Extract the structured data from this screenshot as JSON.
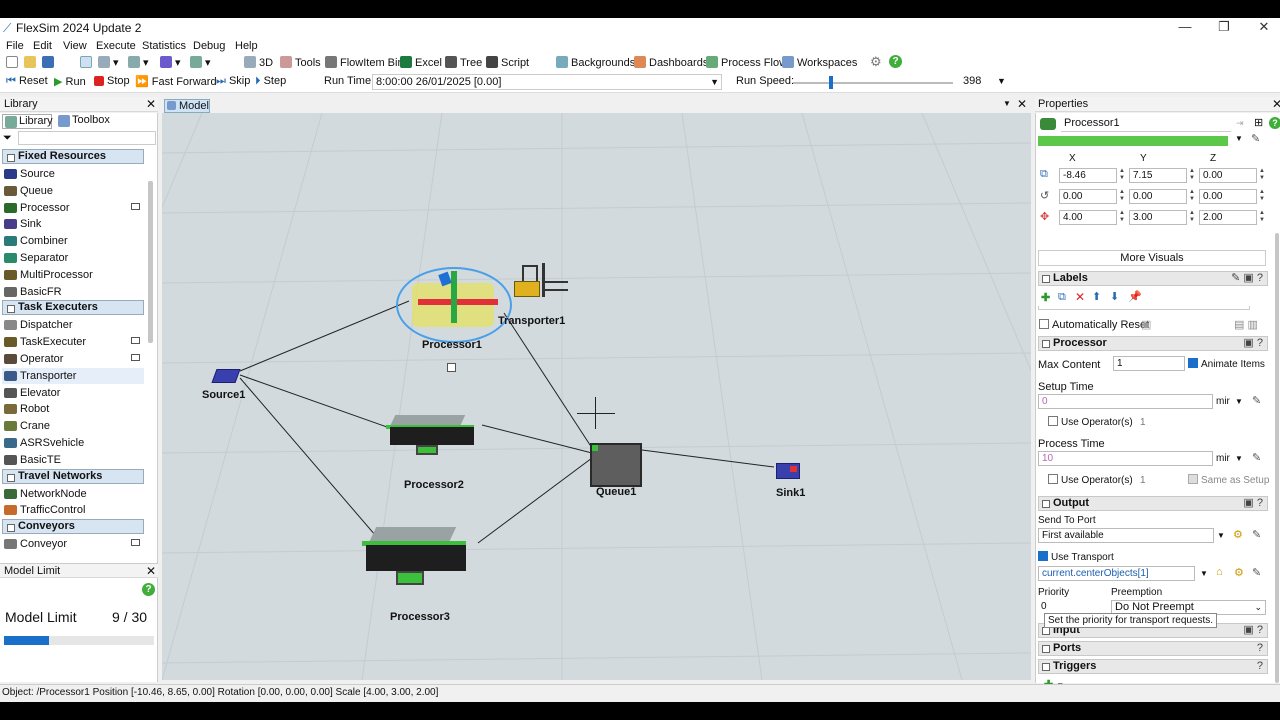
{
  "window": {
    "title": "FlexSim 2024 Update 2",
    "minimize": "—",
    "maximize": "❐",
    "close": "✕"
  },
  "menu": [
    "File",
    "Edit",
    "View",
    "Execute",
    "Statistics",
    "Debug",
    "Help"
  ],
  "toolbar": {
    "view3d": "3D",
    "tools": "Tools",
    "flowitem_bin": "FlowItem Bin",
    "excel": "Excel",
    "tree": "Tree",
    "script": "Script",
    "backgrounds": "Backgrounds",
    "dashboards": "Dashboards",
    "process_flow": "Process Flow",
    "workspaces": "Workspaces"
  },
  "run_controls": {
    "reset": "Reset",
    "run": "Run",
    "stop": "Stop",
    "fast_forward": "Fast Forward",
    "skip": "Skip",
    "step": "Step",
    "run_time_label": "Run Time:",
    "run_time_value": "8:00:00  26/01/2025  [0.00]",
    "run_speed_label": "Run Speed:",
    "run_speed_value": "398"
  },
  "library": {
    "title": "Library",
    "tabs": [
      "Library",
      "Toolbox"
    ],
    "categories": [
      {
        "name": "Fixed Resources",
        "items": [
          "Source",
          "Queue",
          "Processor",
          "Sink",
          "Combiner",
          "Separator",
          "MultiProcessor",
          "BasicFR"
        ]
      },
      {
        "name": "Task Executers",
        "items": [
          "Dispatcher",
          "TaskExecuter",
          "Operator",
          "Transporter",
          "Elevator",
          "Robot",
          "Crane",
          "ASRSvehicle",
          "BasicTE"
        ]
      },
      {
        "name": "Travel Networks",
        "items": [
          "NetworkNode",
          "TrafficControl"
        ]
      },
      {
        "name": "Conveyors",
        "items": [
          "Conveyor"
        ]
      }
    ]
  },
  "model_limit": {
    "panel_title": "Model Limit",
    "label": "Model Limit",
    "value": "9 / 30",
    "progress": 0.3
  },
  "model_tab": "Model",
  "objects": {
    "source": "Source1",
    "processor1": "Processor1",
    "transporter": "Transporter1",
    "processor2": "Processor2",
    "processor3": "Processor3",
    "queue": "Queue1",
    "sink": "Sink1"
  },
  "properties": {
    "title": "Properties",
    "object_name": "Processor1",
    "axes": [
      "X",
      "Y",
      "Z"
    ],
    "position": [
      "-8.46",
      "7.15",
      "0.00"
    ],
    "rotation": [
      "0.00",
      "0.00",
      "0.00"
    ],
    "size": [
      "4.00",
      "3.00",
      "2.00"
    ],
    "more_visuals": "More Visuals",
    "labels_section": "Labels",
    "auto_reset": "Automatically Reset",
    "processor_section": "Processor",
    "max_content_label": "Max Content",
    "max_content": "1",
    "animate_items": "Animate Items",
    "setup_time_label": "Setup Time",
    "setup_time": "0",
    "time_unit": "mir",
    "use_operators": "Use Operator(s)",
    "operator_count": "1",
    "process_time_label": "Process Time",
    "process_time": "10",
    "same_as_setup": "Same as Setup",
    "output_section": "Output",
    "send_to_port_label": "Send To Port",
    "send_to_port": "First available",
    "use_transport": "Use Transport",
    "transport_expr": "current.centerObjects[1]",
    "priority_label": "Priority",
    "priority_value": "0",
    "preemption_label": "Preemption",
    "preemption": "Do Not Preempt",
    "tooltip": "Set the priority for transport requests.",
    "input_section": "Input",
    "ports_section": "Ports",
    "triggers_section": "Triggers"
  },
  "status": "Object: /Processor1 Position [-10.46, 8.65, 0.00]  Rotation [0.00, 0.00, 0.00]  Scale [4.00, 3.00, 2.00]",
  "colors": {
    "accent": "#1a6fc9",
    "green_bar": "#5bc84a",
    "viewport": "#d2dade"
  }
}
